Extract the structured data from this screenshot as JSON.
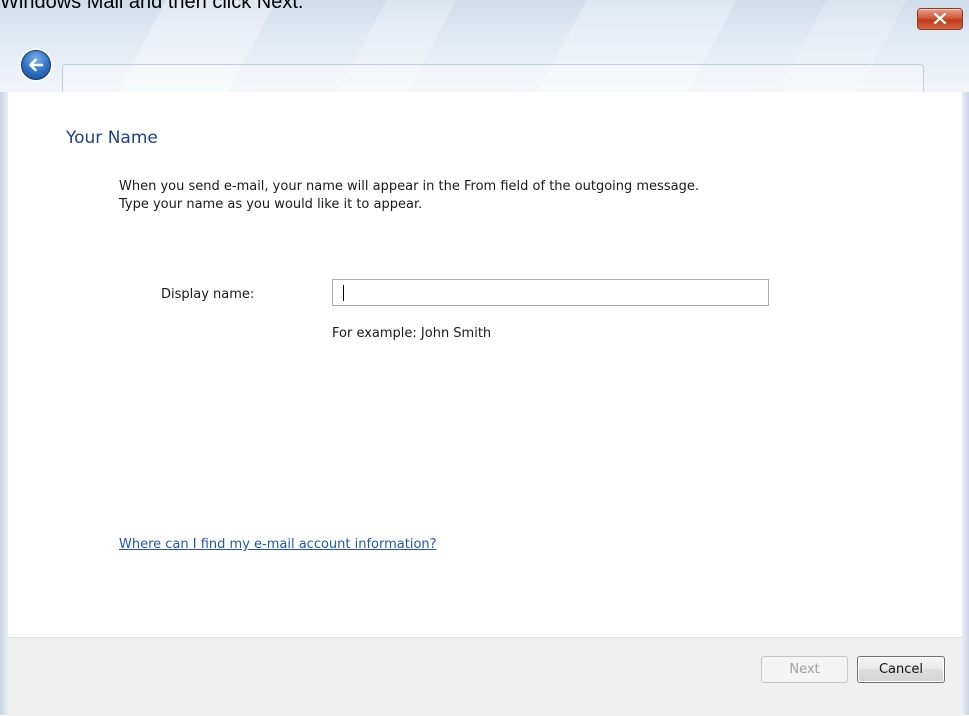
{
  "document": {
    "caption": "Windows Mail and then click Next."
  },
  "window": {
    "close_icon": "close-icon",
    "back_icon": "back-arrow-icon"
  },
  "page": {
    "title": "Your Name",
    "description_line1": "When you send e-mail, your name will appear in the From field of the outgoing message.",
    "description_line2": "Type your name as you would like it to appear."
  },
  "form": {
    "display_name_label": "Display name:",
    "display_name_value": "",
    "display_name_hint": "For example: John Smith"
  },
  "help_link": "Where can I find my e-mail account information?",
  "buttons": {
    "next": "Next",
    "next_enabled": false,
    "cancel": "Cancel"
  },
  "colors": {
    "title_blue": "#1e3f8a",
    "link_blue": "#2355b5",
    "close_red": "#c8452a"
  }
}
